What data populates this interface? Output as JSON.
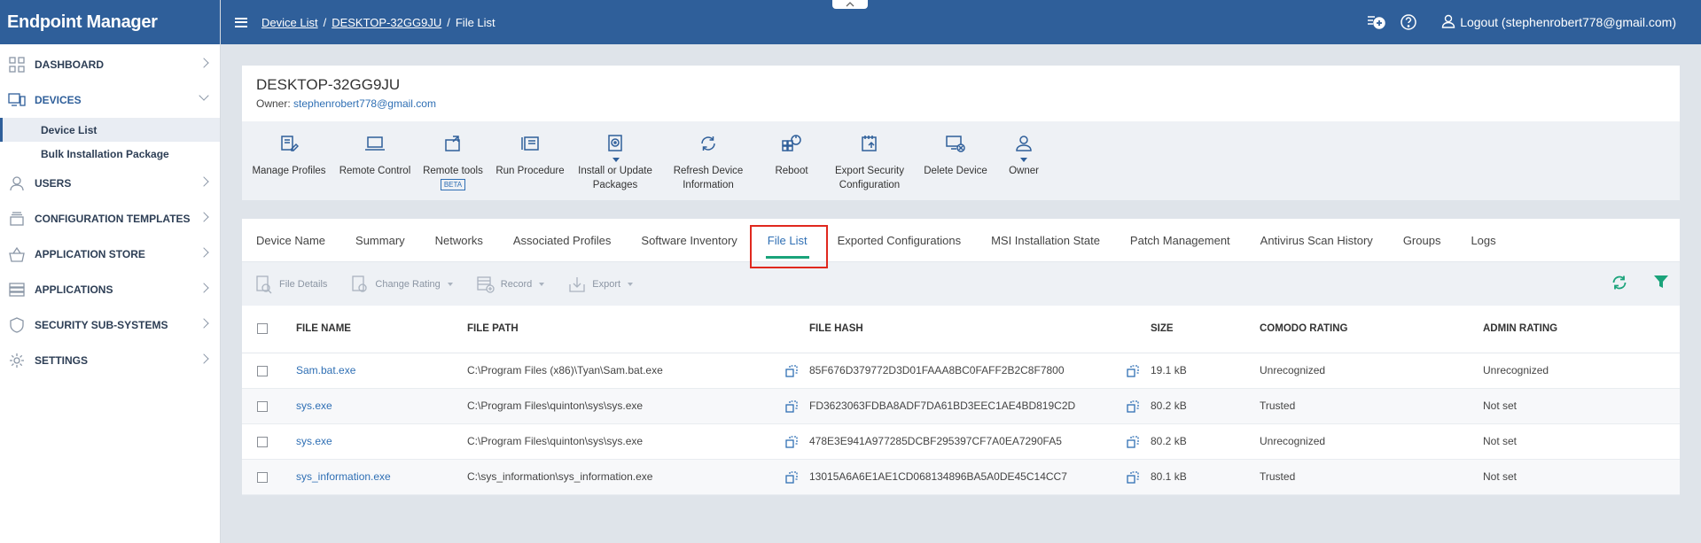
{
  "app": {
    "title": "Endpoint Manager"
  },
  "sidebar": {
    "items": [
      {
        "label": "DASHBOARD",
        "icon": "dashboard-grid-icon"
      },
      {
        "label": "DEVICES",
        "icon": "devices-icon",
        "open": true,
        "children": [
          {
            "label": "Device List",
            "active": true
          },
          {
            "label": "Bulk Installation Package"
          }
        ]
      },
      {
        "label": "USERS",
        "icon": "user-icon"
      },
      {
        "label": "CONFIGURATION TEMPLATES",
        "icon": "stack-icon"
      },
      {
        "label": "APPLICATION STORE",
        "icon": "basket-icon"
      },
      {
        "label": "APPLICATIONS",
        "icon": "applications-icon"
      },
      {
        "label": "SECURITY SUB-SYSTEMS",
        "icon": "shield-icon"
      },
      {
        "label": "SETTINGS",
        "icon": "gear-icon"
      }
    ]
  },
  "header": {
    "breadcrumb": {
      "device_list": "Device List",
      "device": "DESKTOP-32GG9JU",
      "current": "File List",
      "sep": "/"
    },
    "logout": "Logout (stephenrobert778@gmail.com)"
  },
  "device": {
    "name": "DESKTOP-32GG9JU",
    "owner_label": "Owner:",
    "owner_email": "stephenrobert778@gmail.com"
  },
  "toolbar": {
    "manage_profiles": "Manage Profiles",
    "remote_control": "Remote Control",
    "remote_tools": "Remote tools",
    "beta": "BETA",
    "run_procedure": "Run Procedure",
    "install_update_1": "Install or Update",
    "install_update_2": "Packages",
    "refresh_1": "Refresh Device",
    "refresh_2": "Information",
    "reboot": "Reboot",
    "export_1": "Export Security",
    "export_2": "Configuration",
    "delete_device": "Delete Device",
    "owner": "Owner"
  },
  "tabs": {
    "device_name": "Device Name",
    "summary": "Summary",
    "networks": "Networks",
    "associated_profiles": "Associated Profiles",
    "software_inventory": "Software Inventory",
    "file_list": "File List",
    "exported_configurations": "Exported Configurations",
    "msi_installation_state": "MSI Installation State",
    "patch_management": "Patch Management",
    "antivirus_scan_history": "Antivirus Scan History",
    "groups": "Groups",
    "logs": "Logs"
  },
  "actions": {
    "file_details": "File Details",
    "change_rating": "Change Rating",
    "record": "Record",
    "export": "Export"
  },
  "table": {
    "headers": {
      "file_name": "FILE NAME",
      "file_path": "FILE PATH",
      "file_hash": "FILE HASH",
      "size": "SIZE",
      "comodo_rating": "COMODO RATING",
      "admin_rating": "ADMIN RATING"
    },
    "rows": [
      {
        "name": "Sam.bat.exe",
        "path": "C:\\Program Files (x86)\\Tyan\\Sam.bat.exe",
        "hash": "85F676D379772D3D01FAAA8BC0FAFF2B2C8F7800",
        "size": "19.1 kB",
        "comodo": "Unrecognized",
        "admin": "Unrecognized"
      },
      {
        "name": "sys.exe",
        "path": "C:\\Program Files\\quinton\\sys\\sys.exe",
        "hash": "FD3623063FDBA8ADF7DA61BD3EEC1AE4BD819C2D",
        "size": "80.2 kB",
        "comodo": "Trusted",
        "admin": "Not set"
      },
      {
        "name": "sys.exe",
        "path": "C:\\Program Files\\quinton\\sys\\sys.exe",
        "hash": "478E3E941A977285DCBF295397CF7A0EA7290FA5",
        "size": "80.2 kB",
        "comodo": "Unrecognized",
        "admin": "Not set"
      },
      {
        "name": "sys_information.exe",
        "path": "C:\\sys_information\\sys_information.exe",
        "hash": "13015A6A6E1AE1CD068134896BA5A0DE45C14CC7",
        "size": "80.1 kB",
        "comodo": "Trusted",
        "admin": "Not set"
      }
    ]
  },
  "colors": {
    "header_blue": "#2f5f9a",
    "link_blue": "#2f6fb4",
    "active_tab_underline": "#1aa37a",
    "highlight_red": "#e0281e"
  }
}
